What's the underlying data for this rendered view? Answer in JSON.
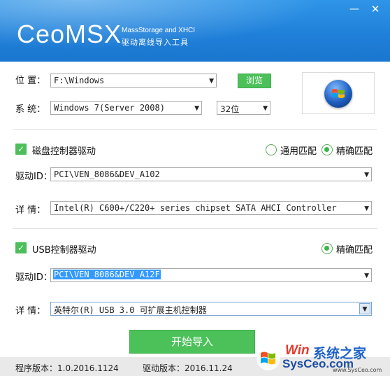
{
  "header": {
    "logo": "CeoMSX",
    "subtitle_en": "MassStorage and XHCI",
    "subtitle_cn": "驱动离线导入工具",
    "minimize_icon": "minimize-icon",
    "close_icon": "close-icon"
  },
  "system": {
    "location_label": "位  置：",
    "location_value": "F:\\Windows",
    "browse_label": "浏览",
    "system_label": "系  统：",
    "system_value": "Windows 7(Server 2008)",
    "arch_value": "32位"
  },
  "disk": {
    "checkbox_label": "磁盘控制器驱动",
    "generic_match": "通用匹配",
    "exact_match": "精确匹配",
    "driver_id_label": "驱动ID：",
    "driver_id_value": "PCI\\VEN_8086&DEV_A102",
    "detail_label": "详  情：",
    "detail_value": "Intel(R) C600+/C220+ series chipset SATA AHCI Controller"
  },
  "usb": {
    "checkbox_label": "USB控制器驱动",
    "exact_match": "精确匹配",
    "driver_id_label": "驱动ID：",
    "driver_id_value": "PCI\\VEN_8086&DEV_A12F",
    "detail_label": "详  情：",
    "detail_value": "英特尔(R) USB 3.0 可扩展主机控制器"
  },
  "actions": {
    "start_import": "开始导入"
  },
  "footer": {
    "program_version": "程序版本：1.0.2016.1124",
    "driver_version": "驱动版本：2016.11.24"
  },
  "watermark": {
    "brand_a": "Win",
    "brand_b": "系统之家",
    "site": "SysCeo.com",
    "site2": "www.SysCeo.com"
  },
  "colors": {
    "header_blue": "#1f7fd8",
    "accent_green": "#4cc15a",
    "selection_blue": "#3399ff"
  }
}
